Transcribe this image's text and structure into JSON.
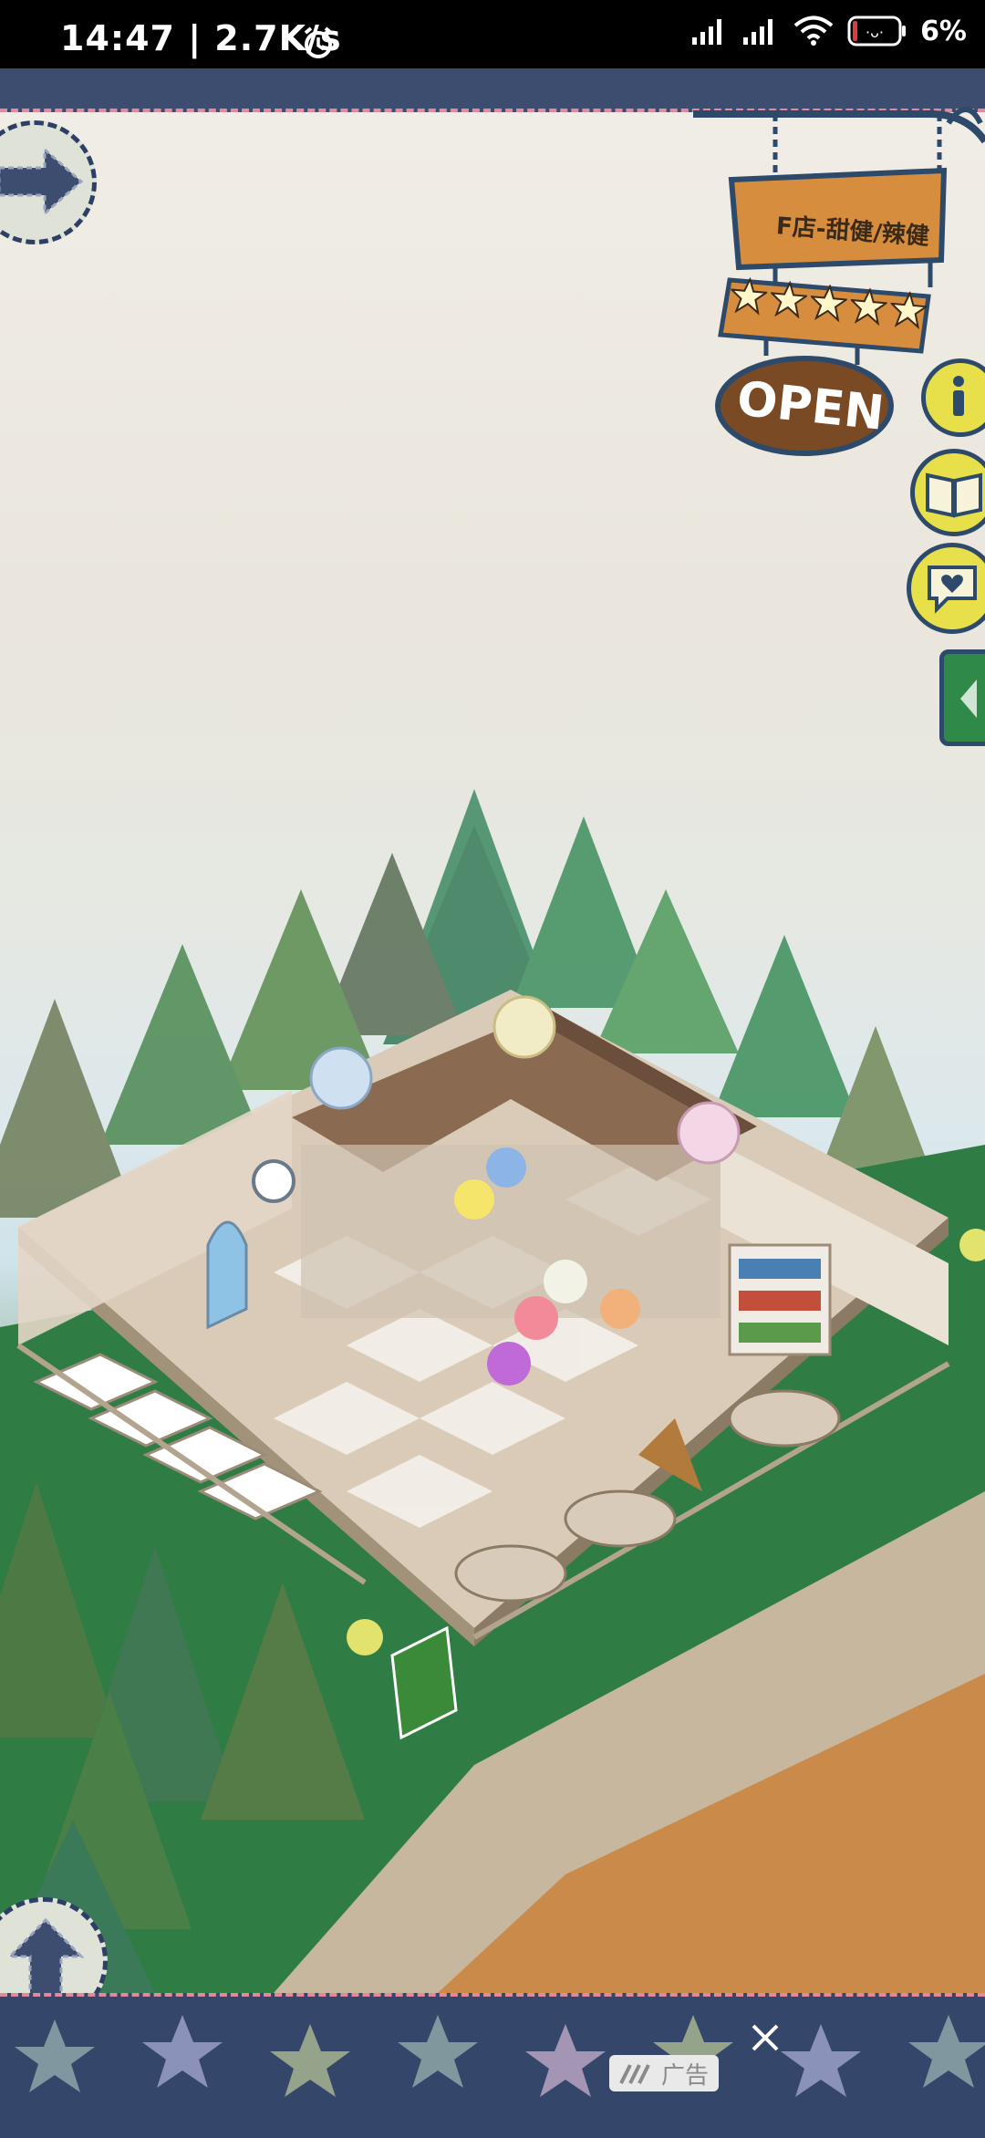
{
  "status_bar": {
    "time_text": "14:47 | 2.7K/s",
    "battery": "6%",
    "icons": [
      "alarm-icon",
      "signal-icon",
      "signal-icon",
      "wifi-icon",
      "battery-icon"
    ]
  },
  "shop_sign": {
    "name": "F店-甜健/辣健",
    "stars": 5,
    "open_label": "OPEN"
  },
  "side_buttons": [
    "info-icon",
    "recipe-book-icon",
    "heart-icon",
    "arrow-left-icon"
  ],
  "nav": {
    "top_left": "arrow-right-icon",
    "bottom_left": "arrow-up-icon"
  },
  "ad": {
    "label": "广告",
    "close_icon": "close-icon"
  },
  "colors": {
    "border_navy": "#3c4d6f",
    "sign_wood": "#d78d3e",
    "open_brown": "#7a4a25",
    "button_yellow": "#e8e04a",
    "grass_green": "#2e7a45"
  }
}
